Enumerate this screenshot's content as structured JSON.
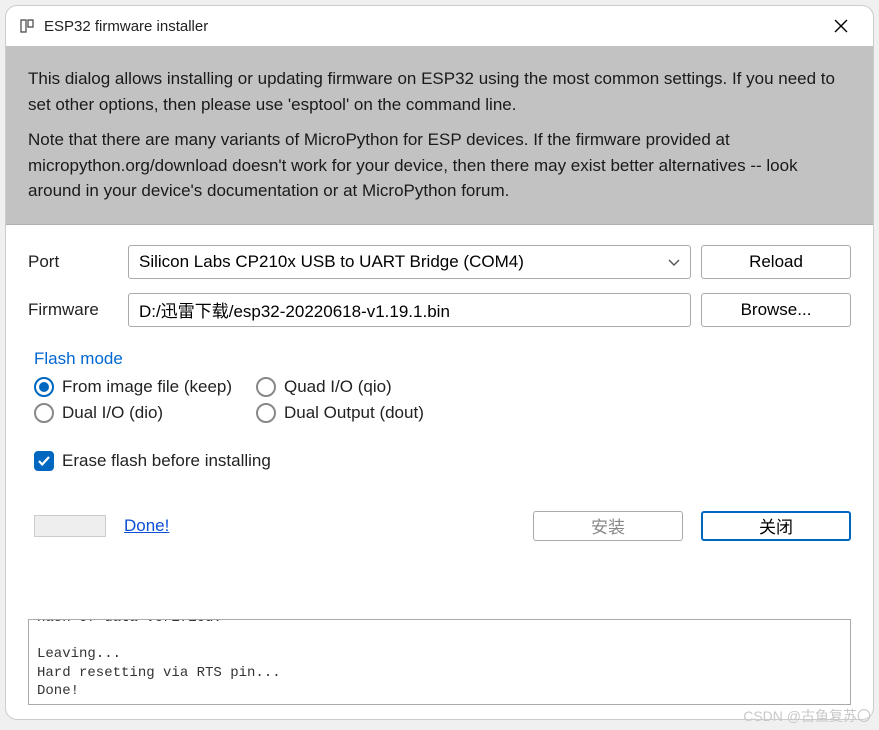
{
  "window": {
    "title": "ESP32 firmware installer"
  },
  "info": {
    "paragraph1": "This dialog allows installing or updating firmware on ESP32 using the most common settings. If you need to set other options, then please use 'esptool' on the command line.",
    "paragraph2": "Note that there are many variants of MicroPython for ESP devices. If the firmware provided at micropython.org/download doesn't work for your device, then there may exist better alternatives -- look around in your device's documentation or at MicroPython forum."
  },
  "form": {
    "port_label": "Port",
    "port_value": "Silicon Labs CP210x USB to UART Bridge (COM4)",
    "reload_label": "Reload",
    "firmware_label": "Firmware",
    "firmware_value": "D:/迅雷下载/esp32-20220618-v1.19.1.bin",
    "browse_label": "Browse..."
  },
  "flash_mode": {
    "legend": "Flash mode",
    "options": {
      "keep": "From image file (keep)",
      "qio": "Quad I/O (qio)",
      "dio": "Dual I/O (dio)",
      "dout": "Dual Output (dout)"
    },
    "selected": "keep"
  },
  "erase": {
    "label": "Erase flash before installing",
    "checked": true
  },
  "progress": {
    "status_label": "Done!"
  },
  "actions": {
    "install_label": "安装",
    "close_label": "关闭"
  },
  "log": "Hash of data verified.\n\nLeaving...\nHard resetting via RTS pin...\nDone!",
  "watermark": "CSDN @古鱼复苏〇"
}
